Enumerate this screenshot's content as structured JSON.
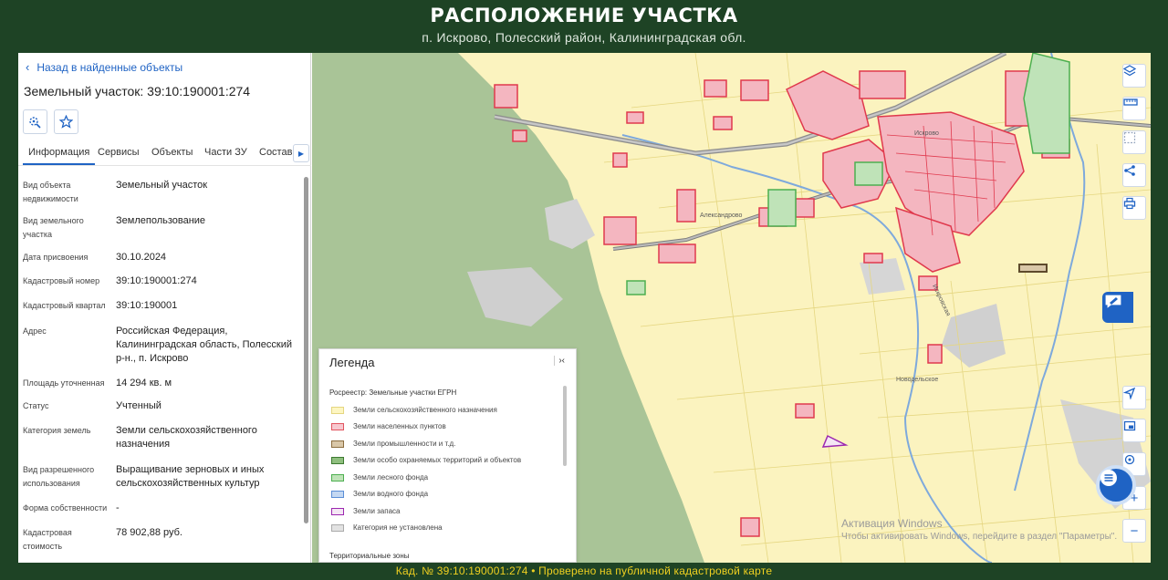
{
  "header": {
    "title": "РАСПОЛОЖЕНИЕ УЧАСТКА",
    "subtitle": "п. Искрово, Полесский район, Калининградская обл."
  },
  "footer": {
    "text": "Кад. № 39:10:190001:274 • Проверено на публичной кадастровой карте"
  },
  "panel": {
    "back_label": "Назад в найденные объекты",
    "title": "Земельный участок: 39:10:190001:274",
    "tabs": [
      {
        "label": "Информация",
        "active": true
      },
      {
        "label": "Сервисы",
        "active": false
      },
      {
        "label": "Объекты",
        "active": false
      },
      {
        "label": "Части ЗУ",
        "active": false
      },
      {
        "label": "Состав",
        "active": false
      }
    ],
    "properties": [
      {
        "key": "Вид объекта недвижимости",
        "value": "Земельный участок"
      },
      {
        "key": "Вид земельного участка",
        "value": "Землепользование"
      },
      {
        "key": "Дата присвоения",
        "value": "30.10.2024"
      },
      {
        "key": "Кадастровый номер",
        "value": "39:10:190001:274"
      },
      {
        "key": "Кадастровый квартал",
        "value": "39:10:190001"
      },
      {
        "key": "Адрес",
        "value": "Российская Федерация, Калининградская область, Полесский р-н., п. Искрово"
      },
      {
        "key": "Площадь уточненная",
        "value": "14 294 кв. м"
      },
      {
        "key": "Статус",
        "value": "Учтенный"
      },
      {
        "key": "Категория земель",
        "value": "Земли сельскохозяйственного назначения"
      },
      {
        "key": "Вид разрешенного использования",
        "value": "Выращивание зерновых и иных сельскохозяйственных культур"
      },
      {
        "key": "Форма собственности",
        "value": "-"
      },
      {
        "key": "Кадастровая стоимость",
        "value": "78 902,88 руб."
      }
    ]
  },
  "legend": {
    "title": "Легенда",
    "toggle": "›‹",
    "subtitle": "Росреестр: Земельные участки ЕГРН",
    "items": [
      {
        "label": "Земли сельскохозяйственного назначения",
        "fill": "#fdf6c2",
        "stroke": "#e5d680"
      },
      {
        "label": "Земли населенных пунктов",
        "fill": "#f7c8cf",
        "stroke": "#e2545f"
      },
      {
        "label": "Земли промышленности и т.д.",
        "fill": "#d9c7a8",
        "stroke": "#8c6d3f"
      },
      {
        "label": "Земли особо охраняемых территорий и объектов",
        "fill": "#8fbf7f",
        "stroke": "#3d7a30"
      },
      {
        "label": "Земли лесного фонда",
        "fill": "#bfe3b8",
        "stroke": "#4caf50"
      },
      {
        "label": "Земли водного фонда",
        "fill": "#c4d8f2",
        "stroke": "#5b8ed6"
      },
      {
        "label": "Земли запаса",
        "fill": "#f4e6f4",
        "stroke": "#9c27b0"
      },
      {
        "label": "Категория не установлена",
        "fill": "#e2e2e2",
        "stroke": "#aaaaaa"
      }
    ],
    "footer": "Территориальные зоны"
  },
  "map": {
    "labels": [
      "Александрово",
      "Искрово",
      "Новодельское",
      "Искровская"
    ],
    "watermark_line1": "Активация Windows",
    "watermark_line2": "Чтобы активировать Windows, перейдите в раздел \"Параметры\"."
  },
  "controls": {
    "icons": [
      "layers-icon",
      "ruler-icon",
      "select-area-icon",
      "share-icon",
      "print-icon",
      "chat-icon",
      "locate-icon",
      "map-view-icon",
      "search-location-icon",
      "zoom-in-icon",
      "zoom-out-icon"
    ],
    "zoom_in": "+",
    "zoom_out": "−"
  }
}
